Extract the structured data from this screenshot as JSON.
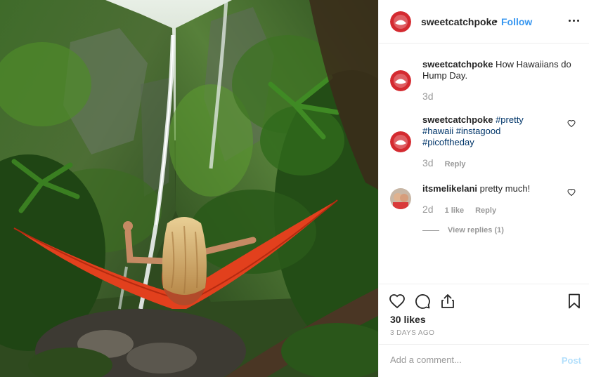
{
  "post": {
    "username": "sweetcatchpoke",
    "separator": "•",
    "follow_label": "Follow",
    "more_icon": "more-options-icon",
    "image_alt": "Woman in a red hammock facing a jungle waterfall"
  },
  "comments": [
    {
      "username": "sweetcatchpoke",
      "text": " How Hawaiians do Hump Day.",
      "time": "3d",
      "avatar": "sweetcatchpoke-logo"
    },
    {
      "username": "sweetcatchpoke",
      "tags": [
        "#pretty",
        "#hawaii",
        "#instagood",
        "#picoftheday"
      ],
      "time": "3d",
      "reply_label": "Reply",
      "avatar": "sweetcatchpoke-logo"
    },
    {
      "username": "itsmelikelani",
      "text": " pretty much!",
      "time": "2d",
      "likes_label": "1 like",
      "reply_label": "Reply",
      "view_replies": "View replies (1)",
      "avatar": "user-photo"
    }
  ],
  "actions": {
    "like_icon": "heart-icon",
    "comment_icon": "comment-icon",
    "share_icon": "share-icon",
    "save_icon": "bookmark-icon",
    "likes": "30 likes",
    "posted": "3 DAYS AGO"
  },
  "add_comment": {
    "placeholder": "Add a comment...",
    "post_label": "Post"
  },
  "colors": {
    "accent": "#3897f0",
    "tag": "#003569",
    "muted": "#999999",
    "post_disabled": "#b2dffc",
    "brand_red": "#d42a30"
  }
}
